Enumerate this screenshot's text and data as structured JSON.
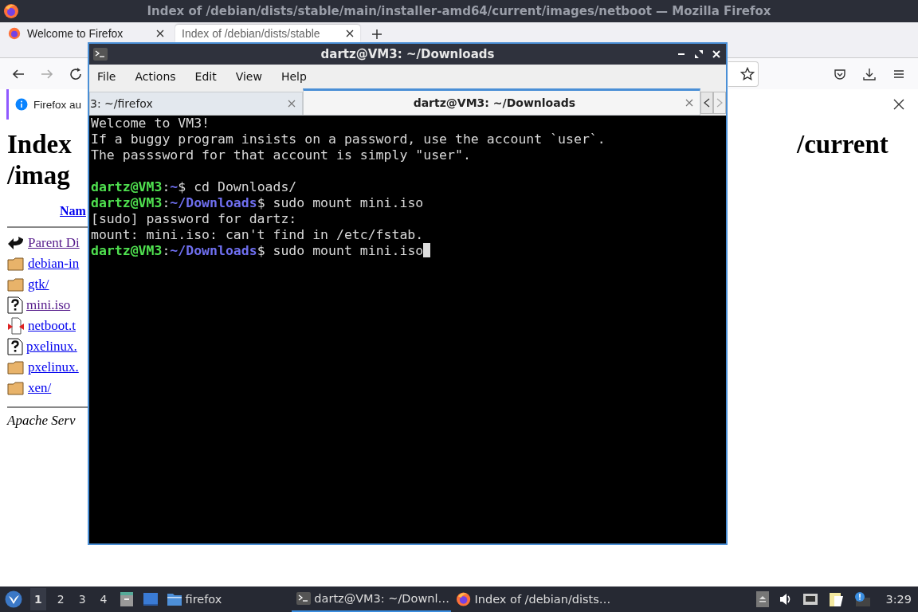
{
  "browser": {
    "title": "Index of /debian/dists/stable/main/installer-amd64/current/images/netboot — Mozilla Firefox",
    "tabs": [
      {
        "label": "Welcome to Firefox",
        "selected": false
      },
      {
        "label": "Index of /debian/dists/stable",
        "selected": true
      }
    ],
    "notification": {
      "text": "Firefox au"
    },
    "page": {
      "heading_left": [
        "Index",
        "/imag"
      ],
      "heading_right": "/current",
      "column_link": "Nam",
      "entries": [
        {
          "kind": "parent",
          "name": "Parent Di",
          "visited": true
        },
        {
          "kind": "folder",
          "name": "debian-in",
          "visited": false
        },
        {
          "kind": "folder",
          "name": "gtk/",
          "visited": false
        },
        {
          "kind": "unknown",
          "name": "mini.iso",
          "visited": true
        },
        {
          "kind": "archive",
          "name": "netboot.t",
          "visited": false
        },
        {
          "kind": "unknown",
          "name": "pxelinux.",
          "visited": false
        },
        {
          "kind": "folder",
          "name": "pxelinux.",
          "visited": false
        },
        {
          "kind": "folder",
          "name": "xen/",
          "visited": false
        }
      ],
      "footer": "Apache Serv"
    }
  },
  "terminal": {
    "title": "dartz@VM3: ~/Downloads",
    "menu": [
      "File",
      "Actions",
      "Edit",
      "View",
      "Help"
    ],
    "tabs": [
      {
        "label": "3: ~/firefox",
        "selected": false
      },
      {
        "label": "dartz@VM3: ~/Downloads",
        "selected": true
      }
    ],
    "lines": [
      {
        "kind": "text",
        "text": "Welcome to VM3!"
      },
      {
        "kind": "text",
        "text": "If a buggy program insists on a password, use the account `user`."
      },
      {
        "kind": "text",
        "text": "The passsword for that account is simply \"user\"."
      },
      {
        "kind": "blank"
      },
      {
        "kind": "prompt",
        "user": "dartz@VM3",
        "separator": ":",
        "path": "~",
        "symbol": "$",
        "command": "cd Downloads/",
        "cursor": false
      },
      {
        "kind": "prompt",
        "user": "dartz@VM3",
        "separator": ":",
        "path": "~/Downloads",
        "symbol": "$",
        "command": "sudo mount mini.iso",
        "cursor": false
      },
      {
        "kind": "text",
        "text": "[sudo] password for dartz:"
      },
      {
        "kind": "text",
        "text": "mount: mini.iso: can't find in /etc/fstab."
      },
      {
        "kind": "prompt",
        "user": "dartz@VM3",
        "separator": ":",
        "path": "~/Downloads",
        "symbol": "$",
        "command": "sudo mount mini.iso",
        "cursor": true
      }
    ]
  },
  "taskbar": {
    "workspaces": [
      {
        "label": "1",
        "selected": true
      },
      {
        "label": "2",
        "selected": false
      },
      {
        "label": "3",
        "selected": false
      },
      {
        "label": "4",
        "selected": false
      }
    ],
    "launchers": [
      {
        "kind": "cabinet"
      },
      {
        "kind": "desktop"
      },
      {
        "kind": "folder",
        "label": "firefox"
      }
    ],
    "tasks": [
      {
        "kind": "terminal",
        "label": "dartz@VM3: ~/Downl…",
        "selected": true
      },
      {
        "kind": "browser",
        "label": "Index of /debian/dists…",
        "selected": false
      }
    ],
    "clock": "3:29"
  }
}
